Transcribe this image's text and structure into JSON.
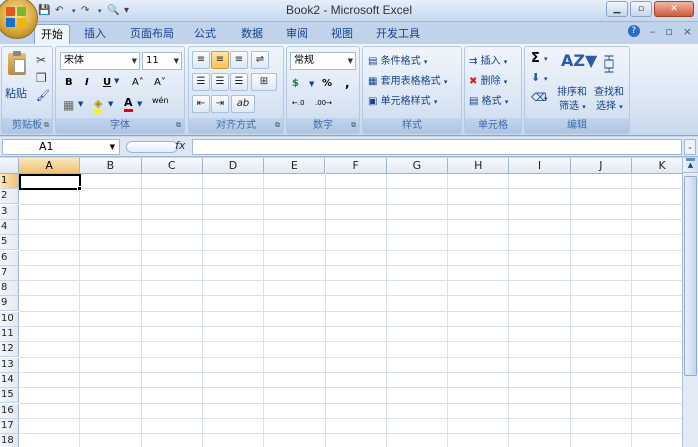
{
  "title": "Book2 - Microsoft Excel",
  "qat": {
    "save": "💾",
    "undo": "↶",
    "redo": "↷",
    "preview": "🔍",
    "more": "▾"
  },
  "window": {
    "minimize": "▁",
    "restore": "▫",
    "close": "✕"
  },
  "tabs": [
    "开始",
    "插入",
    "页面布局",
    "公式",
    "数据",
    "审阅",
    "视图",
    "开发工具"
  ],
  "tab_icons": {
    "help": "?",
    "min": "–",
    "restore": "▫",
    "close": "×"
  },
  "ribbon": {
    "clipboard": {
      "paste": "粘贴",
      "label": "剪贴板",
      "cut": "✂",
      "copy": "❐",
      "format_painter": "🖌"
    },
    "font": {
      "name": "宋体",
      "size": "11",
      "bold": "B",
      "italic": "I",
      "underline": "U",
      "grow": "A˄",
      "shrink": "A˅",
      "border": "▦",
      "fill": "◈",
      "font_color": "A",
      "phonetic": "wén",
      "label": "字体"
    },
    "alignment": {
      "label": "对齐方式",
      "wrap": "⇌",
      "merge": "⊞",
      "indent": "⇥",
      "outdent": "⇤",
      "orient": "ab"
    },
    "number": {
      "format": "常规",
      "currency": "$",
      "percent": "%",
      "comma": ",",
      "inc": ".0→.00",
      "dec": ".00→.0",
      "label": "数字"
    },
    "styles": {
      "conditional": "条件格式",
      "table": "套用表格格式",
      "cell": "单元格样式",
      "label": "样式"
    },
    "cells": {
      "insert": "插入",
      "delete": "删除",
      "format": "格式",
      "label": "单元格"
    },
    "editing": {
      "sum": "Σ",
      "fill": "⬇",
      "clear": "⌫",
      "sort": "排序和",
      "sort2": "筛选",
      "find": "查找和",
      "find2": "选择",
      "label": "编辑"
    }
  },
  "namebox": "A1",
  "fx": "fx",
  "columns": [
    "A",
    "B",
    "C",
    "D",
    "E",
    "F",
    "G",
    "H",
    "I",
    "J",
    "K"
  ],
  "rows": [
    "1",
    "2",
    "3",
    "4",
    "5",
    "6",
    "7",
    "8",
    "9",
    "10",
    "11",
    "12",
    "13",
    "14",
    "15",
    "16",
    "17",
    "18"
  ],
  "active_cell": "A1"
}
